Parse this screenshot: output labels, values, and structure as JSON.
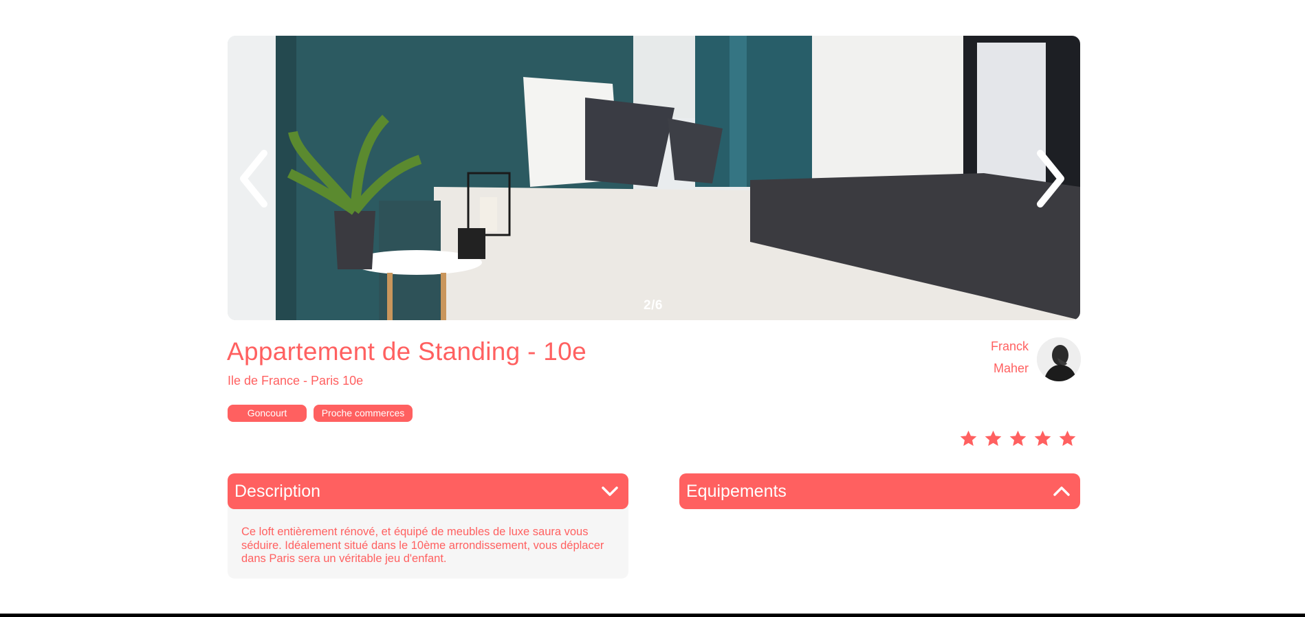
{
  "gallery": {
    "counter": "2/6",
    "prev_icon": "chevron-left-icon",
    "next_icon": "chevron-right-icon"
  },
  "listing": {
    "title": "Appartement de Standing - 10e",
    "location": "Ile de France - Paris 10e",
    "tags": [
      "Goncourt",
      "Proche commerces"
    ]
  },
  "host": {
    "first_name": "Franck",
    "last_name": "Maher"
  },
  "rating": {
    "value": 5,
    "max": 5
  },
  "sections": {
    "description": {
      "title": "Description",
      "text": "Ce loft entièrement rénové, et équipé de meubles de luxe saura vous séduire. Idéalement situé dans le 10ème arrondissement, vous déplacer dans Paris sera un véritable jeu d'enfant.",
      "state": "expanded"
    },
    "equipment": {
      "title": "Equipements",
      "state": "collapsed"
    }
  },
  "colors": {
    "accent": "#ff6060",
    "panel": "#f6f6f6"
  }
}
